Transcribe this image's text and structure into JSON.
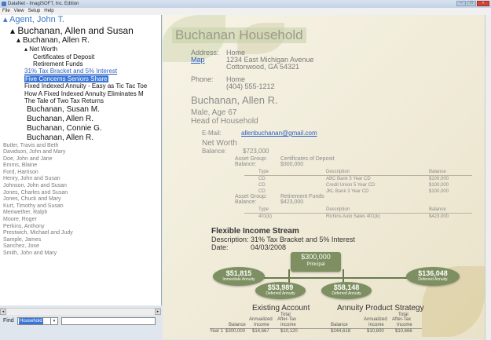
{
  "window": {
    "title": "DataNet - ImagiSOFT, Inc. Edition"
  },
  "menu": [
    "File",
    "View",
    "Setup",
    "Help"
  ],
  "tree": {
    "agent": "Agent, John T.",
    "family": "Buchanan, Allen and Susan",
    "member_open": "Buchanan, Allen R.",
    "net_worth": "Net Worth",
    "assets": [
      "Certificates of Deposit",
      "Retirement Funds"
    ],
    "docs": [
      "31% Tax Bracket and 5% Interest",
      "Five Concerns Seniors Share",
      "Fixed Indexed Annuity - Easy as Tic Tac Toe",
      "How A Fixed Indexed Annuity Eliminates M",
      "The Tale of Two Tax Returns"
    ],
    "members": [
      "Buchanan, Susan M.",
      "Buchanan, Allen R.",
      "Buchanan, Connie G.",
      "Buchanan, Allen R."
    ],
    "clients": [
      "Butler, Travis and Beth",
      "Davidson, John and Mary",
      "Doe, John and Jane",
      "Emms, Blaine",
      "Ford, Harrison",
      "Henry, John and Susan",
      "Johnson, John and Susan",
      "Jones, Charles and Susan",
      "Jones, Chuck and Mary",
      "Kurt, Timothy and Susan",
      "Meriwether, Ralph",
      "Moore, Roger",
      "Perkins, Anthony",
      "Prestwich, Michael and Judy",
      "Sample, James",
      "Sanchez, Jose",
      "Smith, John and Mary"
    ]
  },
  "find": {
    "label": "Find",
    "value": "Household"
  },
  "household": {
    "title": "Buchanan Household",
    "address_label": "Address:",
    "map_link": "Map",
    "address_type": "Home",
    "address_line1": "1234 East Michigan Avenue",
    "address_line2": "Cottonwood, GA  54321",
    "phone_label": "Phone:",
    "phone_type": "Home",
    "phone": "(404) 555-1212"
  },
  "person": {
    "name": "Buchanan, Allen R.",
    "line1": "Male, Age 67",
    "line2": "Head of Household",
    "email_label": "E-Mail:",
    "email": "allenbuchanan@gmail.com",
    "networth_title": "Net Worth",
    "balance_label": "Balance:",
    "balance": "$723,000"
  },
  "asset_groups": [
    {
      "group_label": "Asset Group:",
      "group": "Certificates of Deposit",
      "balance_label": "Balance:",
      "balance": "$300,000",
      "headers": [
        "Type",
        "Description",
        "Balance"
      ],
      "rows": [
        [
          "CD",
          "ABC Bank 5 Year CD",
          "$100,000"
        ],
        [
          "CD",
          "Credit Union 5 Year CD",
          "$100,000"
        ],
        [
          "CD",
          "JKL Bank 3 Year CD",
          "$100,000"
        ]
      ]
    },
    {
      "group_label": "Asset Group:",
      "group": "Retirement Funds",
      "balance_label": "Balance:",
      "balance": "$423,000",
      "headers": [
        "Type",
        "Description",
        "Balance"
      ],
      "rows": [
        [
          "401(k)",
          "Richins Auto Sales 401(k)",
          "$423,000"
        ]
      ]
    }
  ],
  "fis": {
    "title": "Flexible Income Stream",
    "desc_label": "Description:",
    "desc": "31% Tax Bracket and 5% Interest",
    "date_label": "Date:",
    "date": "04/03/2008"
  },
  "diagram": {
    "principal": {
      "amount": "$300,000",
      "label": "Principal"
    },
    "immediate": {
      "amount": "$51,815",
      "label": "Immediate Annuity"
    },
    "deferred1": {
      "amount": "$53,989",
      "label": "Deferred Annuity"
    },
    "deferred2": {
      "amount": "$58,148",
      "label": "Deferred Annuity"
    },
    "deferred3": {
      "amount": "$136,048",
      "label": "Deferred Annuity"
    }
  },
  "comparison": {
    "existing": "Existing Account",
    "strategy": "Annuity Product Strategy",
    "col_total": "Total",
    "col_annualized": "Annualized",
    "col_aftertax": "After-Tax",
    "col_balance": "Balance",
    "col_income": "Income",
    "row_label": "Year 1",
    "row": [
      "$300,000",
      "$14,667",
      "$10,120",
      "$244,618",
      "$10,800",
      "$10,666"
    ]
  },
  "colors": {
    "selection": "#3875d7",
    "link": "#2b5fc2",
    "diagram": "#7e8f62"
  }
}
